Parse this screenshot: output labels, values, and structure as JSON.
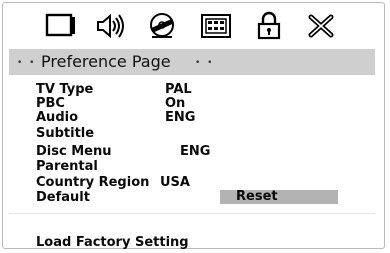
{
  "tabs": [
    {
      "icon": "monitor-icon"
    },
    {
      "icon": "speaker-audio-icon"
    },
    {
      "icon": "video-disc-icon"
    },
    {
      "icon": "preference-panel-icon"
    },
    {
      "icon": "lock-icon"
    },
    {
      "icon": "exit-icon"
    }
  ],
  "header": {
    "left_dots": "• •",
    "title": "Preference Page",
    "right_dots": "• •"
  },
  "settings": [
    {
      "label": "TV Type",
      "value": "PAL"
    },
    {
      "label": "PBC",
      "value": "On"
    },
    {
      "label": "Audio",
      "value": "ENG"
    },
    {
      "label": "Subtitle",
      "value": ""
    },
    {
      "label": "Disc Menu",
      "value": "ENG"
    },
    {
      "label": "Parental",
      "value": ""
    },
    {
      "label": "Country Region",
      "value": "USA"
    },
    {
      "label": "Default",
      "value": ""
    }
  ],
  "submenu": {
    "selected_option": "Reset"
  },
  "footer": {
    "hint": "Load Factory Setting"
  },
  "colors": {
    "header_bg": "#cfcfcf",
    "selection_bg": "#b3b3b3",
    "text": "#0a0a0a"
  }
}
